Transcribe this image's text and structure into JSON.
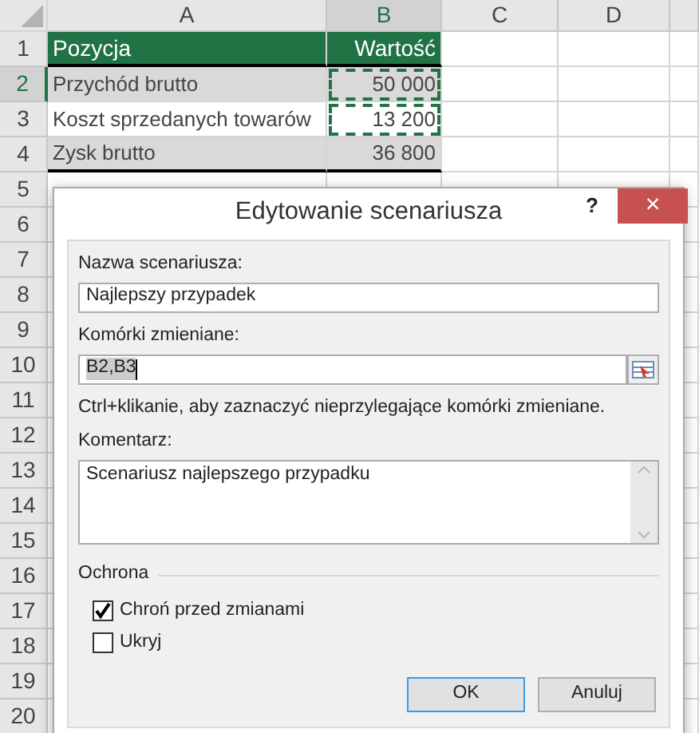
{
  "sheet": {
    "columns": [
      {
        "label": "A",
        "selected": false
      },
      {
        "label": "B",
        "selected": true
      },
      {
        "label": "C",
        "selected": false
      },
      {
        "label": "D",
        "selected": false
      }
    ],
    "row_numbers": [
      {
        "label": "1",
        "selected": false
      },
      {
        "label": "2",
        "selected": true
      },
      {
        "label": "3",
        "selected": false
      },
      {
        "label": "4",
        "selected": false
      },
      {
        "label": "5",
        "selected": false
      },
      {
        "label": "6",
        "selected": false
      },
      {
        "label": "7",
        "selected": false
      },
      {
        "label": "8",
        "selected": false
      },
      {
        "label": "9",
        "selected": false
      },
      {
        "label": "10",
        "selected": false
      },
      {
        "label": "11",
        "selected": false
      },
      {
        "label": "12",
        "selected": false
      },
      {
        "label": "13",
        "selected": false
      },
      {
        "label": "14",
        "selected": false
      },
      {
        "label": "15",
        "selected": false
      },
      {
        "label": "16",
        "selected": false
      },
      {
        "label": "17",
        "selected": false
      },
      {
        "label": "18",
        "selected": false
      },
      {
        "label": "19",
        "selected": false
      },
      {
        "label": "20",
        "selected": false
      }
    ],
    "rows": [
      {
        "kind": "header",
        "cells": [
          {
            "text": "Pozycja",
            "marquee": false
          },
          {
            "text": "Wartość",
            "marquee": false
          }
        ]
      },
      {
        "kind": "shaded",
        "cells": [
          {
            "text": "Przychód brutto",
            "marquee": false
          },
          {
            "text": "50 000",
            "marquee": true
          }
        ]
      },
      {
        "kind": "plain",
        "cells": [
          {
            "text": "Koszt sprzedanych towarów",
            "marquee": false
          },
          {
            "text": "13 200",
            "marquee": true
          }
        ]
      },
      {
        "kind": "total",
        "cells": [
          {
            "text": "Zysk brutto",
            "marquee": false
          },
          {
            "text": "36 800",
            "marquee": false
          }
        ]
      }
    ]
  },
  "dialog": {
    "title": "Edytowanie scenariusza",
    "help": "?",
    "close": "×",
    "name_label": "Nazwa scenariusza:",
    "name_value": "Najlepszy przypadek",
    "cells_label": "Komórki zmieniane:",
    "cells_value": "B2,B3",
    "cells_value_selected": true,
    "hint": "Ctrl+klikanie, aby zaznaczyć nieprzylegające komórki zmieniane.",
    "comment_label": "Komentarz:",
    "comment_value": "Scenariusz najlepszego przypadku",
    "group": "Ochrona",
    "checkboxes": [
      {
        "label": "Chroń przed zmianami",
        "checked": true
      },
      {
        "label": "Ukryj",
        "checked": false
      }
    ],
    "buttons": [
      {
        "label": "OK",
        "default": true
      },
      {
        "label": "Anuluj",
        "default": false
      }
    ]
  }
}
